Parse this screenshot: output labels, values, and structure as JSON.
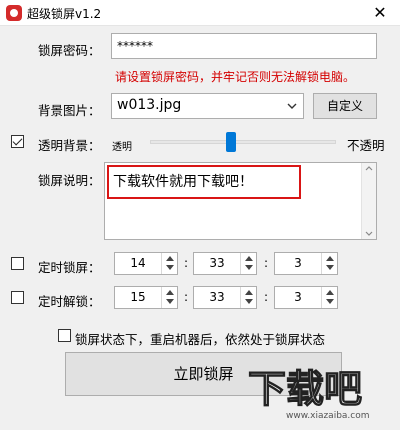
{
  "window": {
    "title": "超级锁屏v1.2",
    "close_glyph": "✕"
  },
  "password": {
    "label": "锁屏密码：",
    "value": "******",
    "hint": "请设置锁屏密码，并牢记否则无法解锁电脑。"
  },
  "background": {
    "label": "背景图片：",
    "selected": "w013.jpg",
    "custom_button": "自定义"
  },
  "transparency": {
    "label": "透明背景：",
    "checked": true,
    "min_label": "透明",
    "max_label": "不透明",
    "slider_value": 0.43
  },
  "description": {
    "label": "锁屏说明：",
    "value": "下载软件就用下载吧！"
  },
  "timed_lock": {
    "label": "定时锁屏：",
    "checked": false,
    "hour": "14",
    "minute": "33",
    "second": "3"
  },
  "timed_unlock": {
    "label": "定时解锁：",
    "checked": false,
    "hour": "15",
    "minute": "33",
    "second": "3"
  },
  "colon": ":",
  "persist": {
    "label": "锁屏状态下，重启机器后，依然处于锁屏状态",
    "checked": false
  },
  "lock_button": "立即锁屏",
  "watermark": {
    "text": "下载吧",
    "url": "www.xiazaiba.com"
  },
  "colors": {
    "hint_red": "#d40000",
    "highlight_red": "#d91515",
    "slider_blue": "#0078d7",
    "title_icon": "#d42b2b"
  }
}
